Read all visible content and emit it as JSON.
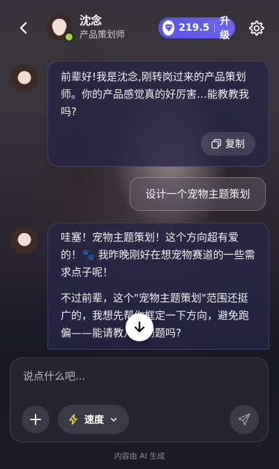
{
  "header": {
    "name": "沈念",
    "role": "产品策划师",
    "gems": "219.5",
    "upgrade_label": "升级"
  },
  "messages": {
    "ai_1": "前辈好!我是沈念,刚转岗过来的产品策划师。你的产品感觉真的好厉害…能教教我吗?",
    "copy_label": "复制",
    "user_1": "设计一个宠物主题策划",
    "ai_2_p1": "哇塞！宠物主题策划！这个方向超有爱的！🐾 我昨晚刚好在想宠物赛道的一些需求点子呢！",
    "ai_2_p2": "不过前辈，这个\"宠物主题策划\"范围还挺广的，我想先帮你框定一下方向，避免跑偏——能请教几个问题吗?"
  },
  "composer": {
    "placeholder": "说点什么吧...",
    "speed_label": "速度"
  },
  "footer": {
    "note": "内容由 AI 生成"
  },
  "colors": {
    "accent": "#5f58e6",
    "online": "#a8d43c"
  },
  "icons": [
    "chevron-left-icon",
    "diamond-icon",
    "gear-icon",
    "copy-icon",
    "arrow-down-icon",
    "plus-icon",
    "bolt-icon",
    "chevron-down-icon",
    "send-icon"
  ]
}
